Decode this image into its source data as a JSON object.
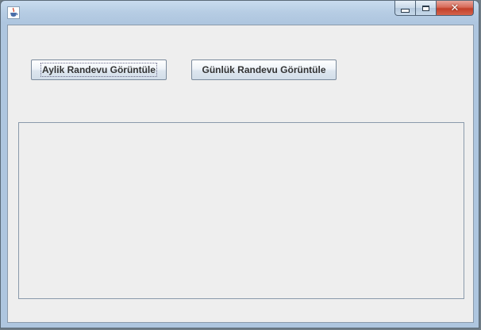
{
  "window": {
    "icon": "java-cup-icon",
    "controls": {
      "minimize_icon": "minimize-icon",
      "maximize_icon": "maximize-icon",
      "close_icon": "close-icon",
      "close_glyph": "✕"
    }
  },
  "toolbar": {
    "monthly_button_label": "Aylik Randevu Görüntüle",
    "daily_button_label": "Günlük Randevu Görüntüle"
  },
  "colors": {
    "titlebar": "#aec6df",
    "client_background": "#eeeeee",
    "close_button": "#c2402a"
  }
}
